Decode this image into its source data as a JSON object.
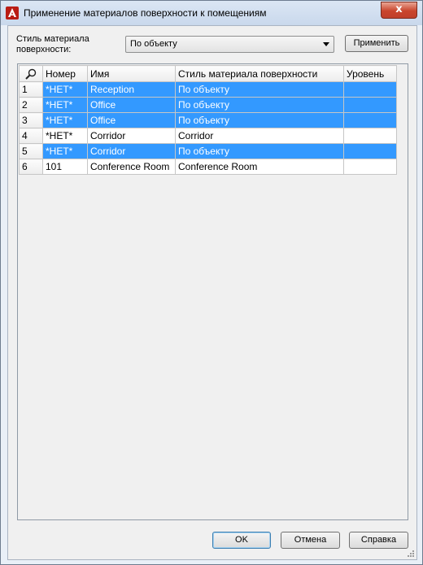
{
  "window": {
    "title": "Применение материалов поверхности к помещениям",
    "close_label": "x"
  },
  "toolbar": {
    "style_label": "Стиль материала поверхности:",
    "style_value": "По объекту",
    "apply_label": "Применить"
  },
  "grid": {
    "columns": [
      "Номер",
      "Имя",
      "Стиль материала поверхности",
      "Уровень"
    ],
    "rows": [
      {
        "index": "1",
        "number": "*НЕТ*",
        "name": "Reception",
        "style": "По объекту",
        "level": "",
        "selected": true
      },
      {
        "index": "2",
        "number": "*НЕТ*",
        "name": "Office",
        "style": "По объекту",
        "level": "",
        "selected": true
      },
      {
        "index": "3",
        "number": "*НЕТ*",
        "name": "Office",
        "style": "По объекту",
        "level": "",
        "selected": true
      },
      {
        "index": "4",
        "number": "*НЕТ*",
        "name": "Corridor",
        "style": "Corridor",
        "level": "",
        "selected": false
      },
      {
        "index": "5",
        "number": "*НЕТ*",
        "name": "Corridor",
        "style": "По объекту",
        "level": "",
        "selected": true
      },
      {
        "index": "6",
        "number": "101",
        "name": "Conference Room",
        "style": "Conference Room",
        "level": "",
        "selected": false
      }
    ]
  },
  "footer": {
    "ok_label": "OK",
    "cancel_label": "Отмена",
    "help_label": "Справка"
  },
  "colors": {
    "selection": "#3399ff",
    "app_icon": "#c8251c"
  },
  "icons": {
    "app": "autocad-logo-icon",
    "grid_corner": "search-icon"
  }
}
